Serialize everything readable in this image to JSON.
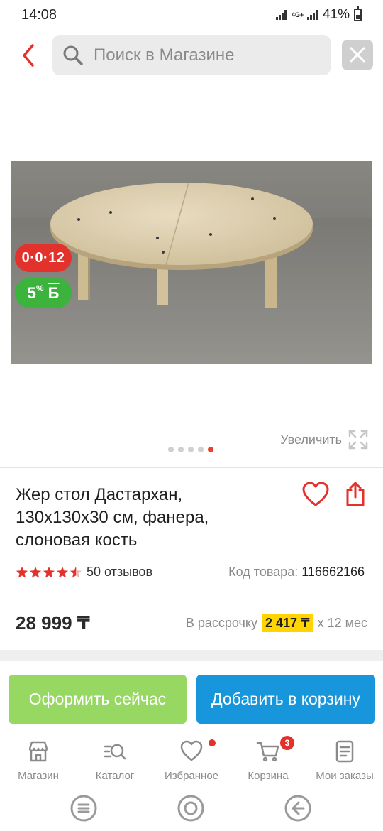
{
  "status_bar": {
    "time": "14:08",
    "network": "4G+",
    "battery": "41%"
  },
  "search": {
    "placeholder": "Поиск в Магазине"
  },
  "gallery": {
    "badge_installment": "0·0·12",
    "badge_bonus_value": "5",
    "badge_bonus_sup": "%",
    "badge_bonus_suffix": "Б",
    "zoom_label": "Увеличить",
    "slide_count": 5,
    "active_slide": 5
  },
  "product": {
    "title": "Жер стол Дастархан, 130x130x30 см, фанера, слоновая кость",
    "rating": 4.5,
    "reviews": "50 отзывов",
    "sku_label": "Код товара:",
    "sku_value": "116662166",
    "price": "28 999 ₸",
    "installment_prefix": "В рассрочку",
    "installment_amount": "2 417 ₸",
    "installment_suffix": "х 12 мес"
  },
  "actions": {
    "buy_now": "Оформить сейчас",
    "add_to_cart": "Добавить в корзину"
  },
  "bottom_nav": {
    "items": [
      {
        "label": "Магазин"
      },
      {
        "label": "Каталог"
      },
      {
        "label": "Избранное"
      },
      {
        "label": "Корзина",
        "count": "3"
      },
      {
        "label": "Мои заказы"
      }
    ]
  },
  "colors": {
    "accent_red": "#e3312c",
    "buy_green": "#96d862",
    "cart_blue": "#1796dc",
    "installment_yellow": "#ffd400"
  }
}
